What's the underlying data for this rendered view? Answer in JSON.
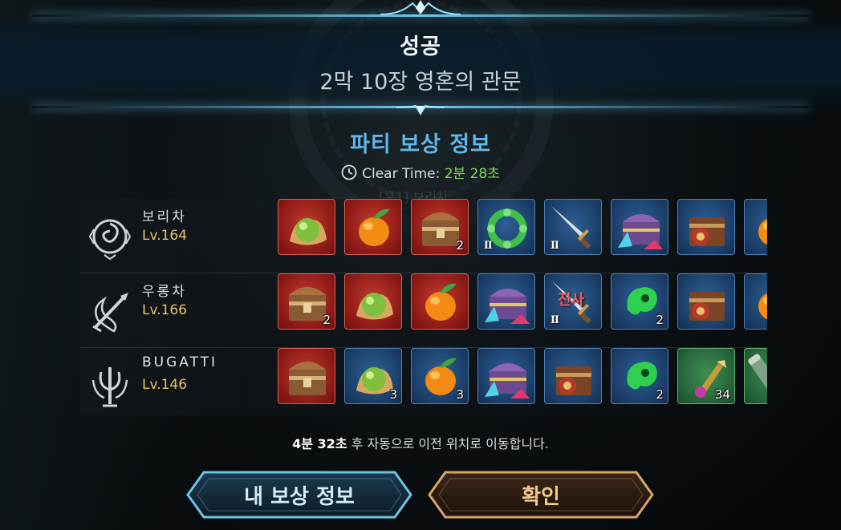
{
  "header": {
    "result_title": "성공",
    "stage_name": "2막 10장 영혼의 관문"
  },
  "reward_info": {
    "heading": "파티 보상 정보",
    "clear_time_label": "Clear Time:",
    "clear_time_value": "2분 28초",
    "ghost_text": "[흑1] 보리차"
  },
  "party": [
    {
      "name": "보리차",
      "level": "Lv.164",
      "emblem": "spiral-emblem-icon",
      "items": [
        {
          "icon": "green-orb-icon",
          "rarity": "red",
          "count": "",
          "tier": "",
          "tag": ""
        },
        {
          "icon": "orange-fruit-icon",
          "rarity": "red",
          "count": "",
          "tier": "",
          "tag": ""
        },
        {
          "icon": "treasure-chest-icon",
          "rarity": "red",
          "count": "2",
          "tier": "",
          "tag": ""
        },
        {
          "icon": "jade-bracelet-icon",
          "rarity": "blue",
          "count": "",
          "tier": "Ⅱ",
          "tag": ""
        },
        {
          "icon": "dagger-icon",
          "rarity": "blue",
          "count": "",
          "tier": "Ⅱ",
          "tag": ""
        },
        {
          "icon": "crystal-chest-icon",
          "rarity": "blue",
          "count": "",
          "tier": "",
          "tag": ""
        },
        {
          "icon": "orb-chest-icon",
          "rarity": "blue",
          "count": "",
          "tier": "",
          "tag": ""
        },
        {
          "icon": "orange-fruit-icon",
          "rarity": "blue",
          "count": "",
          "tier": "",
          "tag": ""
        }
      ]
    },
    {
      "name": "우롱차",
      "level": "Lv.166",
      "emblem": "dragon-sword-emblem-icon",
      "items": [
        {
          "icon": "treasure-chest-icon",
          "rarity": "red",
          "count": "2",
          "tier": "",
          "tag": ""
        },
        {
          "icon": "green-orb-icon",
          "rarity": "red",
          "count": "",
          "tier": "",
          "tag": ""
        },
        {
          "icon": "orange-fruit-icon",
          "rarity": "red",
          "count": "",
          "tier": "",
          "tag": ""
        },
        {
          "icon": "crystal-chest-icon",
          "rarity": "blue",
          "count": "",
          "tier": "",
          "tag": ""
        },
        {
          "icon": "dagger-icon",
          "rarity": "blue",
          "count": "",
          "tier": "Ⅱ",
          "tag": "진사"
        },
        {
          "icon": "jade-magatama-icon",
          "rarity": "blue",
          "count": "2",
          "tier": "",
          "tag": ""
        },
        {
          "icon": "orb-chest-icon",
          "rarity": "blue",
          "count": "",
          "tier": "",
          "tag": ""
        },
        {
          "icon": "orange-fruit-icon",
          "rarity": "blue",
          "count": "",
          "tier": "",
          "tag": ""
        }
      ]
    },
    {
      "name": "BUGATTI",
      "level": "Lv.146",
      "emblem": "trident-emblem-icon",
      "items": [
        {
          "icon": "treasure-chest-icon",
          "rarity": "red",
          "count": "",
          "tier": "",
          "tag": ""
        },
        {
          "icon": "green-orb-icon",
          "rarity": "blue",
          "count": "3",
          "tier": "",
          "tag": ""
        },
        {
          "icon": "orange-fruit-icon",
          "rarity": "blue",
          "count": "3",
          "tier": "",
          "tag": ""
        },
        {
          "icon": "crystal-chest-icon",
          "rarity": "blue",
          "count": "",
          "tier": "",
          "tag": ""
        },
        {
          "icon": "orb-chest-icon",
          "rarity": "blue",
          "count": "",
          "tier": "",
          "tag": ""
        },
        {
          "icon": "jade-magatama-icon",
          "rarity": "blue",
          "count": "2",
          "tier": "",
          "tag": ""
        },
        {
          "icon": "potion-vial-icon",
          "rarity": "green",
          "count": "34",
          "tier": "",
          "tag": ""
        },
        {
          "icon": "scroll-tube-icon",
          "rarity": "green",
          "count": "",
          "tier": "",
          "tag": ""
        }
      ]
    }
  ],
  "footer": {
    "auto_move_time": "4분 32초",
    "auto_move_text": "후 자동으로 이전 위치로 이동합니다.",
    "my_reward_label": "내 보상 정보",
    "confirm_label": "확인"
  },
  "colors": {
    "accent_blue": "#5fb6ea",
    "clear_time_green": "#7ed957",
    "level_gold": "#e6c463",
    "confirm_gold": "#f3c98a"
  }
}
